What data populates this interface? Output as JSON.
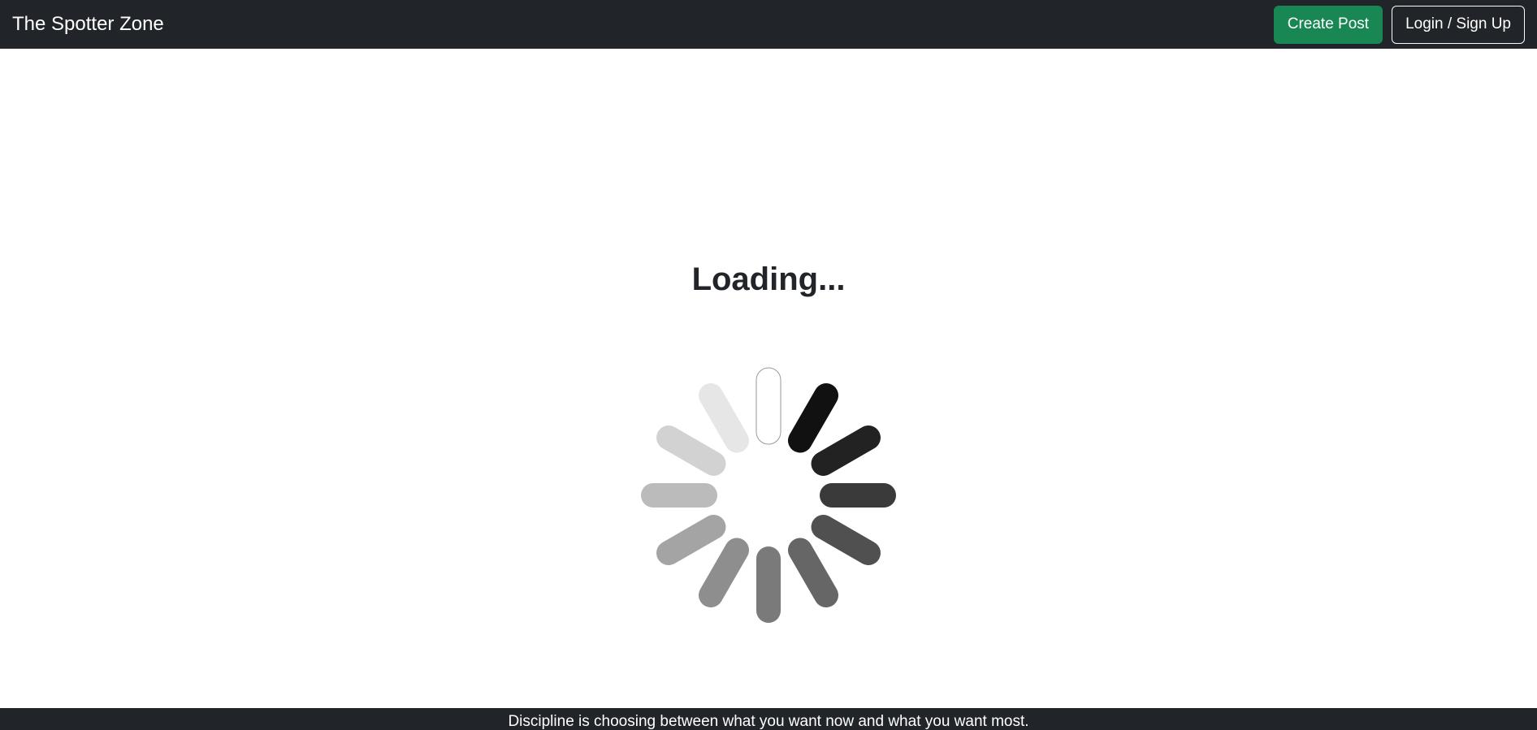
{
  "navbar": {
    "brand": "The Spotter Zone",
    "create_post_label": "Create Post",
    "login_label": "Login / Sign Up"
  },
  "main": {
    "loading_text": "Loading..."
  },
  "footer": {
    "quote": "Discipline is choosing between what you want now and what you want most."
  },
  "colors": {
    "navbar_bg": "#212529",
    "create_button": "#198754",
    "page_bg": "#ffffff"
  },
  "spinner": {
    "icon": "loading-spinner-icon",
    "spoke_count": 12
  }
}
